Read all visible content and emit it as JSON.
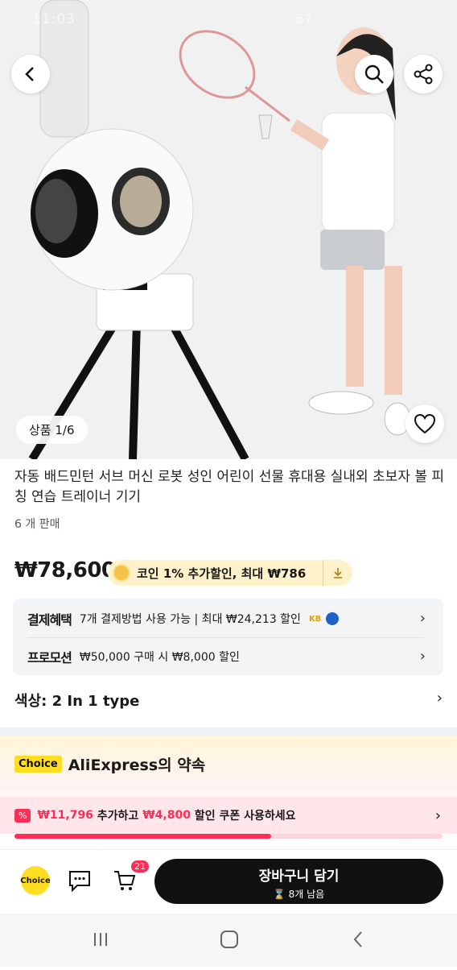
{
  "status_bar": {
    "time": "11:03",
    "battery": "67"
  },
  "gallery": {
    "counter": "상품 1/6"
  },
  "product": {
    "title": "자동 배드민턴 서브 머신 로봇 성인 어린이 선물 휴대용 실내외 초보자 볼 피칭 연습 트레이너 기기",
    "sold": "6 개 판매",
    "price": "₩78,600",
    "coin_text": "코인 1% 추가할인, 최대 ₩786"
  },
  "benefits": {
    "payment_label": "결제혜택",
    "payment_text": "7개 결제방법 사용 가능 | 최대 ₩24,213 할인",
    "promo_label": "프로모션",
    "promo_text": "₩50,000 구매 시 ₩8,000 할인"
  },
  "option": {
    "color": "색상: 2 In 1 type"
  },
  "choice": {
    "tag": "Choice",
    "title": "AliExpress의 약속"
  },
  "coupon": {
    "badge": "%",
    "amount1": "₩11,796",
    "mid": " 추가하고 ",
    "amount2": "₩4,800",
    "end": " 할인 쿠폰 사용하세요",
    "progress": 0.6
  },
  "bottom": {
    "choice_icon": "Choice",
    "cart_badge": "21",
    "cart_label": "장바구니 담기",
    "cart_sub": "8개 남음"
  },
  "colors": {
    "accent": "#ff2d55",
    "coin_bg": "#fff1c9",
    "choice_yellow": "#ffde22"
  }
}
